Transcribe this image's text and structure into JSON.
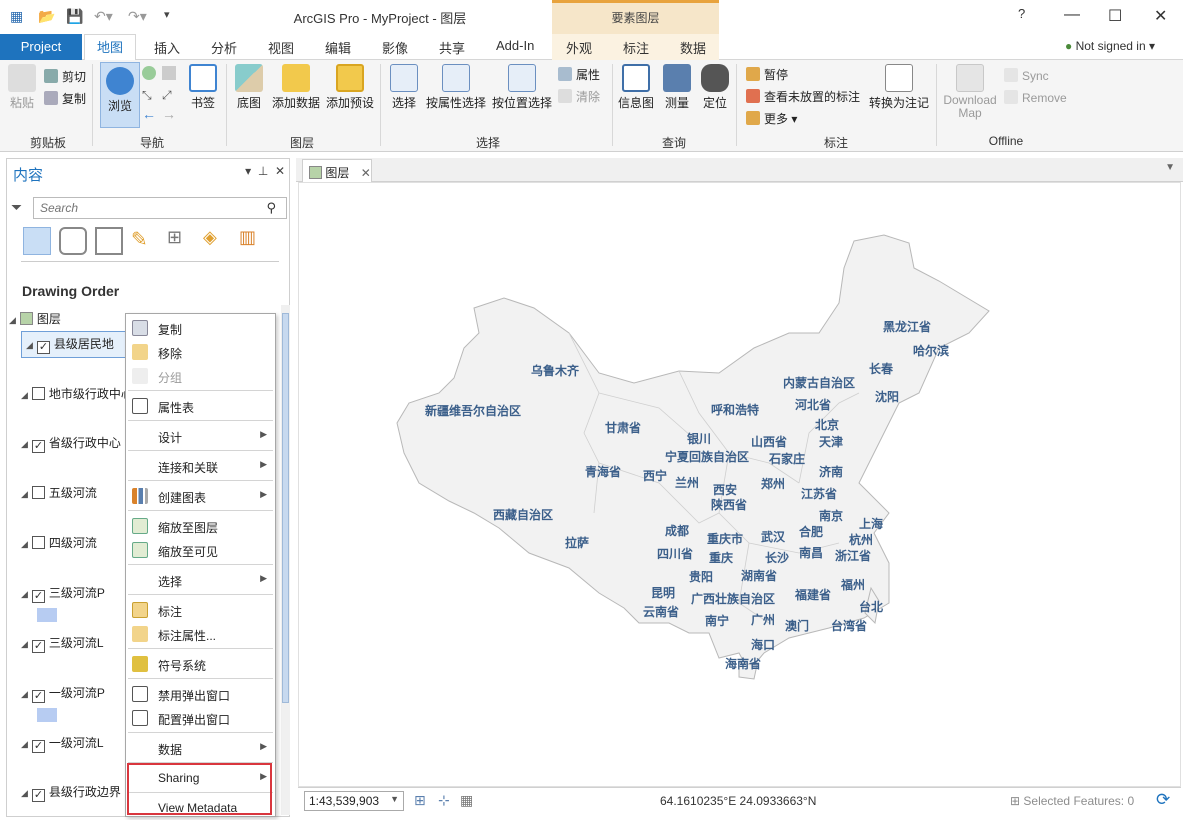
{
  "window": {
    "title": "ArcGIS Pro - MyProject - 图层",
    "context_tab_group": "要素图层",
    "help": "?",
    "minimize": "—",
    "maximize": "☐",
    "close": "✕"
  },
  "tabs": {
    "project": "Project",
    "map": "地图",
    "insert": "插入",
    "analysis": "分析",
    "view": "视图",
    "edit": "编辑",
    "imagery": "影像",
    "share": "共享",
    "addin": "Add-In",
    "appearance": "外观",
    "labeling": "标注",
    "data": "数据",
    "signin": "Not signed in ▾"
  },
  "ribbon": {
    "clipboard": {
      "paste": "粘贴",
      "cut": "剪切",
      "copy": "复制",
      "group": "剪贴板"
    },
    "navigate": {
      "explore": "浏览",
      "bookmarks": "书签",
      "group": "导航"
    },
    "layer": {
      "basemap": "底图",
      "add_data": "添加数据",
      "add_preset": "添加预设",
      "group": "图层"
    },
    "selection": {
      "select": "选择",
      "by_attr": "按属性选择",
      "by_location": "按位置选择",
      "attributes": "属性",
      "clear": "清除",
      "group": "选择"
    },
    "inquiry": {
      "infographics": "信息图",
      "measure": "测量",
      "locate": "定位",
      "group": "查询"
    },
    "labeling": {
      "pause": "暂停",
      "view_unplaced": "查看未放置的标注",
      "more": "更多 ▾",
      "convert": "转换为注记",
      "group": "标注"
    },
    "offline": {
      "download": "Download Map",
      "sync": "Sync",
      "remove": "Remove",
      "group": "Offline"
    }
  },
  "contents": {
    "title": "内容",
    "search_placeholder": "Search",
    "drawing_order": "Drawing Order",
    "map_name": "图层",
    "layers": [
      "县级居民地",
      "地市级行政中心",
      "省级行政中心",
      "五级河流",
      "四级河流",
      "三级河流P",
      "三级河流L",
      "一级河流P",
      "一级河流L",
      "县级行政边界"
    ]
  },
  "context_menu": {
    "items": [
      "复制",
      "移除",
      "分组",
      "属性表",
      "设计",
      "连接和关联",
      "创建图表",
      "缩放至图层",
      "缩放至可见",
      "选择",
      "标注",
      "标注属性...",
      "符号系统",
      "禁用弹出窗口",
      "配置弹出窗口",
      "数据",
      "Sharing",
      "View Metadata"
    ]
  },
  "map": {
    "tab": "图层",
    "cities": [
      "黑龙江省",
      "哈尔滨",
      "长春",
      "沈阳",
      "乌鲁木齐",
      "内蒙古自治区",
      "新疆维吾尔自治区",
      "呼和浩特",
      "河北省",
      "北京",
      "甘肃省",
      "银川",
      "山西省",
      "天津",
      "宁夏回族自治区",
      "石家庄",
      "青海省",
      "西宁",
      "济南",
      "兰州",
      "郑州",
      "西安",
      "江苏省",
      "陕西省",
      "西藏自治区",
      "南京",
      "上海",
      "成都",
      "重庆市",
      "合肥",
      "杭州",
      "拉萨",
      "武汉",
      "四川省",
      "重庆",
      "长沙",
      "南昌",
      "浙江省",
      "贵阳",
      "湖南省",
      "昆明",
      "福州",
      "广西壮族自治区",
      "福建省",
      "台北",
      "云南省",
      "南宁",
      "广州",
      "澳门",
      "台湾省",
      "海口",
      "海南省"
    ]
  },
  "status": {
    "scale": "1:43,539,903",
    "coordinates": "64.1610235°E 24.0933663°N",
    "selected": "Selected Features: 0"
  }
}
